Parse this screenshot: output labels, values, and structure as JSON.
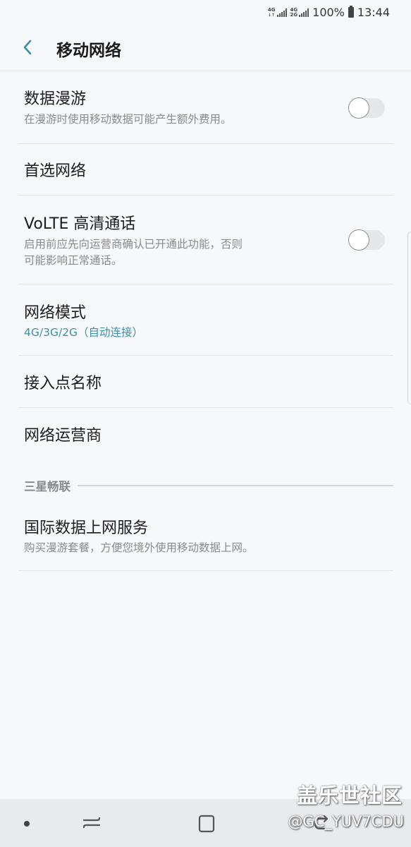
{
  "status_bar": {
    "net1": [
      "4G",
      ""
    ],
    "net2": [
      "4G",
      "2G"
    ],
    "battery": "100%",
    "time": "13:44"
  },
  "header": {
    "title": "移动网络"
  },
  "settings": {
    "data_roaming": {
      "title": "数据漫游",
      "subtitle": "在漫游时使用移动数据可能产生额外费用。",
      "toggle_on": false
    },
    "preferred_network": {
      "title": "首选网络"
    },
    "volte": {
      "title": "VoLTE 高清通话",
      "subtitle_line1": "启用前应先向运营商确认已开通此功能，否则",
      "subtitle_line2": "可能影响正常通话。",
      "toggle_on": false
    },
    "network_mode": {
      "title": "网络模式",
      "value": "4G/3G/2G（自动连接）"
    },
    "apn": {
      "title": "接入点名称"
    },
    "network_operator": {
      "title": "网络运营商"
    }
  },
  "section": {
    "label": "三星畅联"
  },
  "international": {
    "title": "国际数据上网服务",
    "subtitle": "购买漫游套餐，方便您境外使用移动数据上网。"
  },
  "watermark": {
    "title": "盖乐世社区",
    "handle": "@GC_YUV7CDU"
  },
  "colors": {
    "background": "#f7f8fa",
    "accent": "#3d8fa8",
    "subtext": "#8a8a8a",
    "divider": "#e3e3e3"
  }
}
